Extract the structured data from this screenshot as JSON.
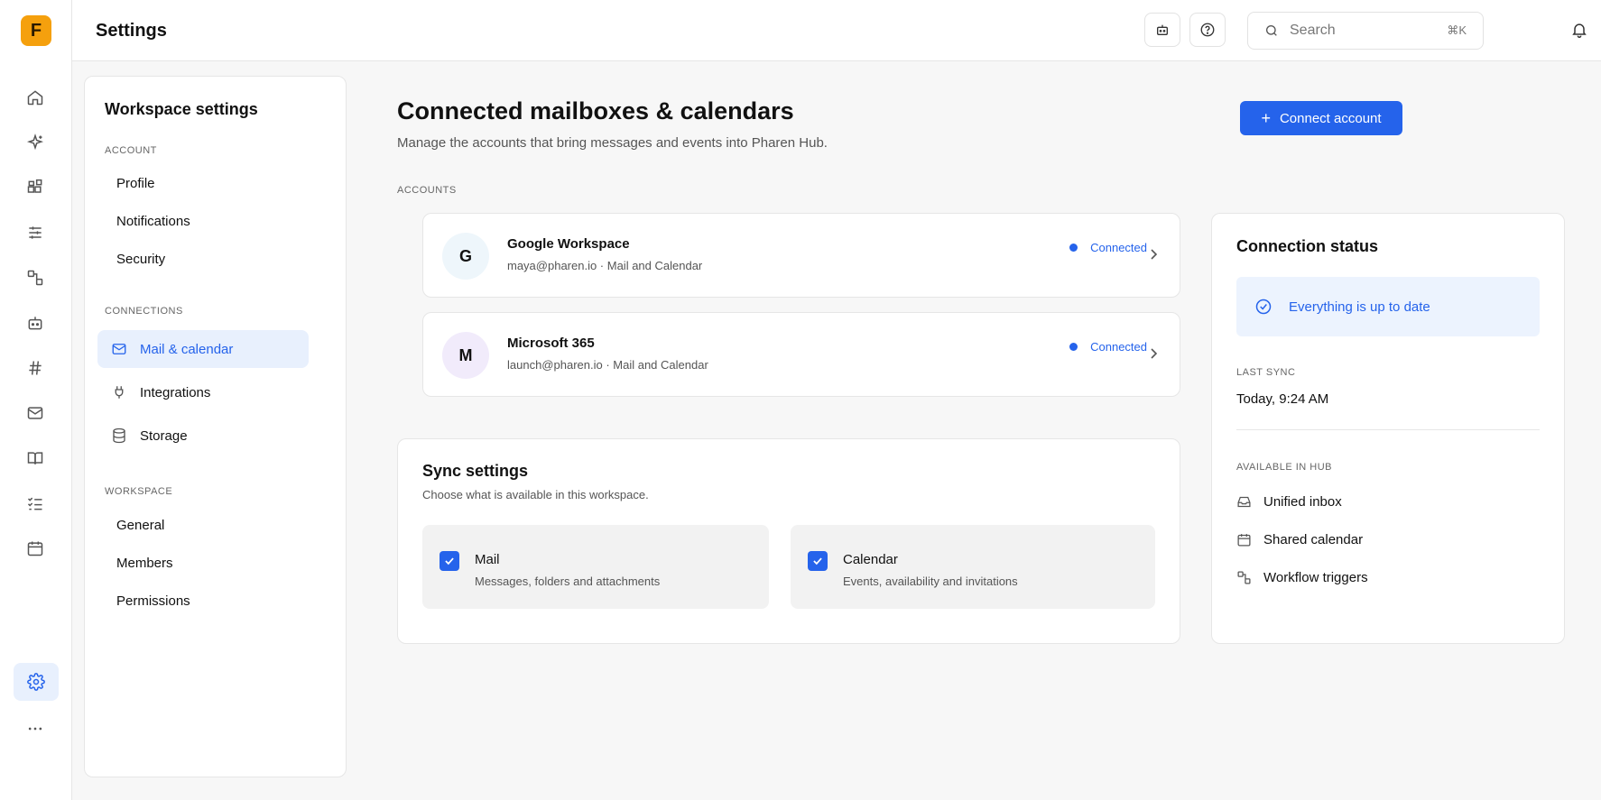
{
  "app": {
    "logo_letter": "F",
    "page_title": "Settings",
    "accent_color": "#2563eb",
    "logo_color": "#f5a00d"
  },
  "rail": {
    "icons": [
      "home-icon",
      "sparkles-icon",
      "widgets-icon",
      "sliders-icon",
      "workflow-icon",
      "bot-icon",
      "hash-icon",
      "mail-icon",
      "book-icon",
      "checklist-icon",
      "calendar-icon"
    ],
    "active_icon": "gear-icon",
    "more_icon": "more-icon"
  },
  "topbar": {
    "search_placeholder": "Search",
    "search_shortcut": "⌘K"
  },
  "settings_nav": {
    "title": "Workspace settings",
    "sections": [
      {
        "label": "ACCOUNT",
        "items": [
          "Profile",
          "Notifications",
          "Security"
        ]
      },
      {
        "label": "CONNECTIONS",
        "items": [
          "Mail & calendar",
          "Integrations",
          "Storage"
        ]
      },
      {
        "label": "WORKSPACE",
        "items": [
          "General",
          "Members",
          "Permissions"
        ]
      }
    ],
    "active_item": "Mail & calendar"
  },
  "main": {
    "title": "Connected mailboxes & calendars",
    "subtitle": "Manage the accounts that bring messages and events into Pharen Hub.",
    "connect_button": "Connect account",
    "accounts_label": "ACCOUNTS",
    "accounts": [
      {
        "initial": "G",
        "name": "Google Workspace",
        "meta": "maya@pharen.io · Mail and Calendar",
        "status": "Connected",
        "avatar_bg": "#eef6fb"
      },
      {
        "initial": "M",
        "name": "Microsoft 365",
        "meta": "launch@pharen.io · Mail and Calendar",
        "status": "Connected",
        "avatar_bg": "#f1ebfb"
      }
    ]
  },
  "sync": {
    "title": "Sync settings",
    "subtitle": "Choose what is available in this workspace.",
    "options": [
      {
        "title": "Mail",
        "subtitle": "Messages, folders and attachments",
        "checked": true
      },
      {
        "title": "Calendar",
        "subtitle": "Events, availability and invitations",
        "checked": true
      }
    ]
  },
  "status": {
    "title": "Connection status",
    "banner": "Everything is up to date",
    "last_sync_label": "LAST SYNC",
    "last_sync_value": "Today, 9:24 AM",
    "available_label": "AVAILABLE IN HUB",
    "available_items": [
      "Unified inbox",
      "Shared calendar",
      "Workflow triggers"
    ]
  }
}
